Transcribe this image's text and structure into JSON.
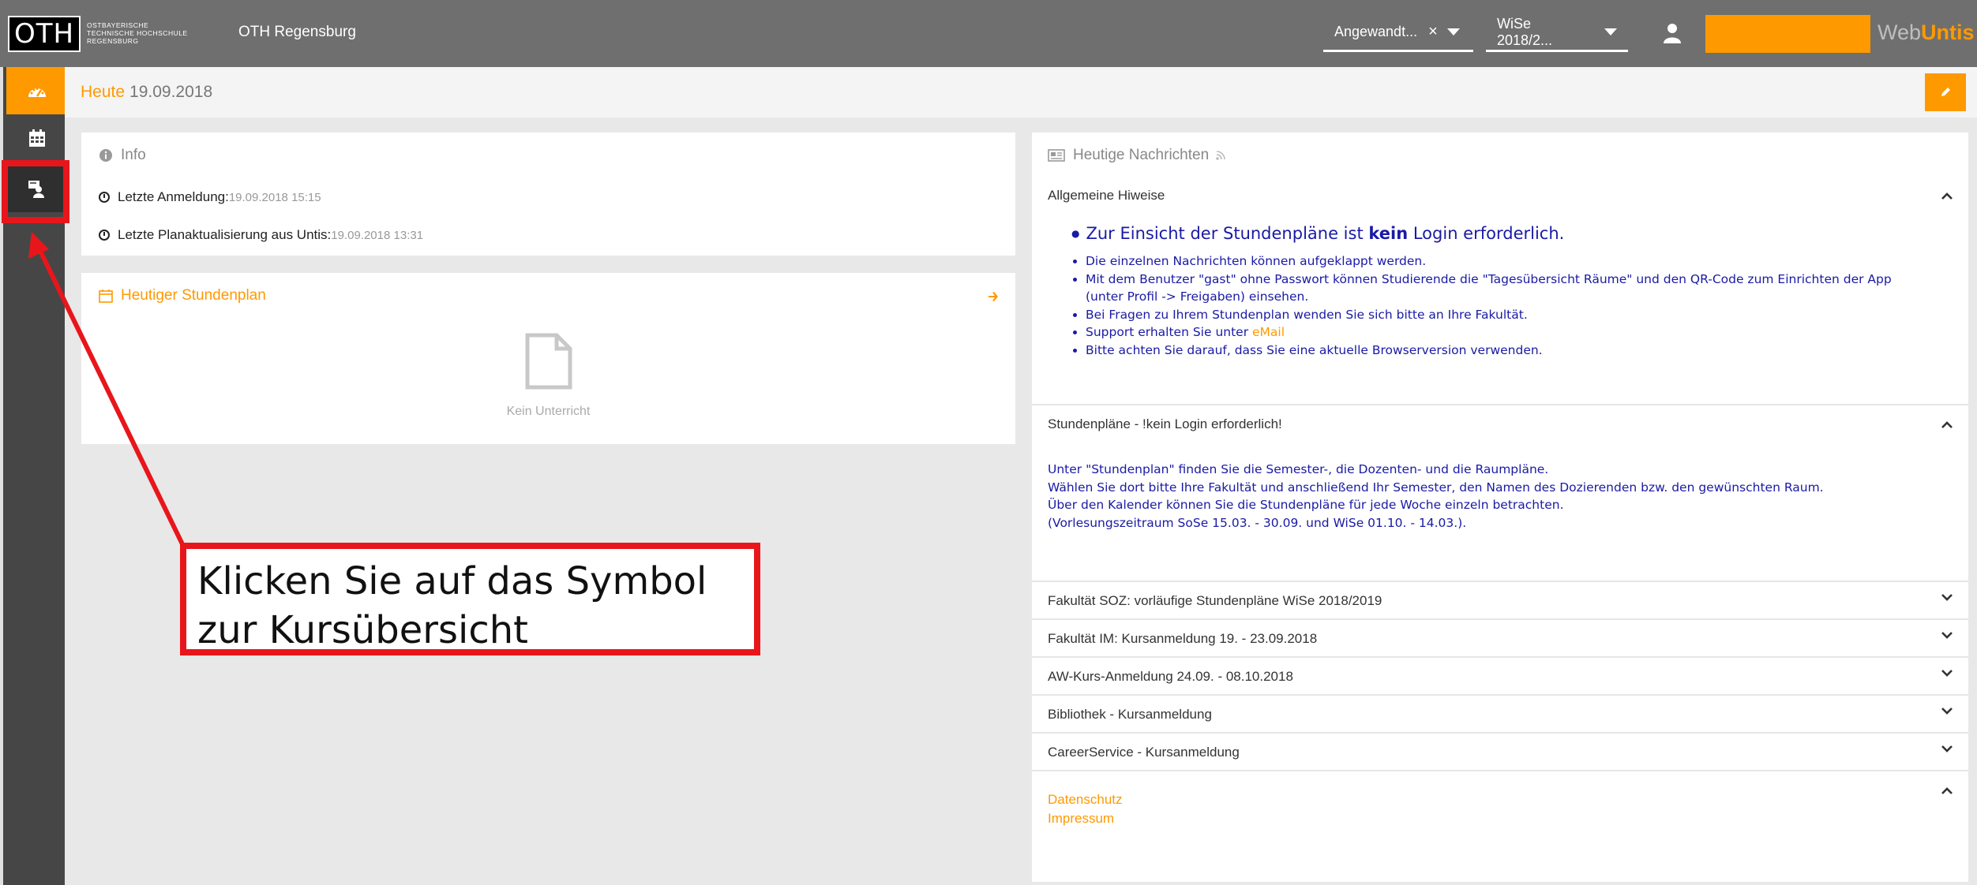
{
  "header": {
    "logo_text": "OTH",
    "logo_sub_lines": [
      "OSTBAYERISCHE",
      "TECHNISCHE HOCHSCHULE",
      "REGENSBURG"
    ],
    "school_name": "OTH Regensburg",
    "select_department": "Angewandt...",
    "select_semester": "WiSe 2018/2...",
    "brand_web": "Web",
    "brand_untis": "Untis"
  },
  "subheader": {
    "today_label": "Heute",
    "today_date": "19.09.2018"
  },
  "info": {
    "title": "Info",
    "last_login_label": "Letzte Anmeldung:",
    "last_login_value": "19.09.2018 15:15",
    "last_update_label": "Letzte Planaktualisierung aus Untis:",
    "last_update_value": "19.09.2018 13:31"
  },
  "timetable": {
    "title": "Heutiger Stundenplan",
    "empty_text": "Kein Unterricht"
  },
  "news": {
    "title": "Heutige Nachrichten",
    "section1": {
      "title": "Allgemeine Hiweise",
      "headline_pre": "Zur Einsicht der Stundenpläne ist ",
      "headline_bold": "kein",
      "headline_post": " Login erforderlich.",
      "items": [
        "Die einzelnen Nachrichten können aufgeklappt werden.",
        "Mit dem Benutzer \"gast\" ohne Passwort können Studierende die \"Tagesübersicht Räume\" und den QR-Code zum Einrichten der App",
        "(unter Profil -> Freigaben) einsehen.",
        "Bei Fragen zu Ihrem Stundenplan wenden Sie sich bitte an Ihre Fakultät.",
        "Support erhalten Sie unter ",
        "Bitte achten Sie darauf, dass Sie eine aktuelle Browserversion verwenden."
      ],
      "email_link": "eMail"
    },
    "section2": {
      "title": "Stundenpläne - !kein Login erforderlich!",
      "lines": [
        "Unter \"Stundenplan\" finden Sie die Semester-, die Dozenten- und die Raumpläne.",
        "Wählen Sie dort bitte Ihre Fakultät und anschließend Ihr Semester, den Namen des Dozierenden bzw. den gewünschten Raum.",
        "Über den Kalender können Sie die Stundenpläne für jede Woche einzeln betrachten.",
        "(Vorlesungszeitraum SoSe 15.03. - 30.09. und WiSe 01.10. - 14.03.)."
      ]
    },
    "collapsed": [
      "Fakultät SOZ: vorläufige Stundenpläne WiSe 2018/2019",
      "Fakultät IM: Kursanmeldung 19. - 23.09.2018",
      "AW-Kurs-Anmeldung 24.09. - 08.10.2018",
      "Bibliothek - Kursanmeldung",
      "CareerService - Kursanmeldung"
    ],
    "footer_links": [
      "Datenschutz",
      "Impressum"
    ]
  },
  "annotation": {
    "line1": "Klicken Sie auf das Symbol",
    "line2": "zur Kursübersicht"
  },
  "colors": {
    "accent": "#ff9900",
    "topbar": "#6f6f6f",
    "sidebar": "#464646",
    "annotation_red": "#e8161b",
    "news_blue": "#1a1aa6"
  }
}
